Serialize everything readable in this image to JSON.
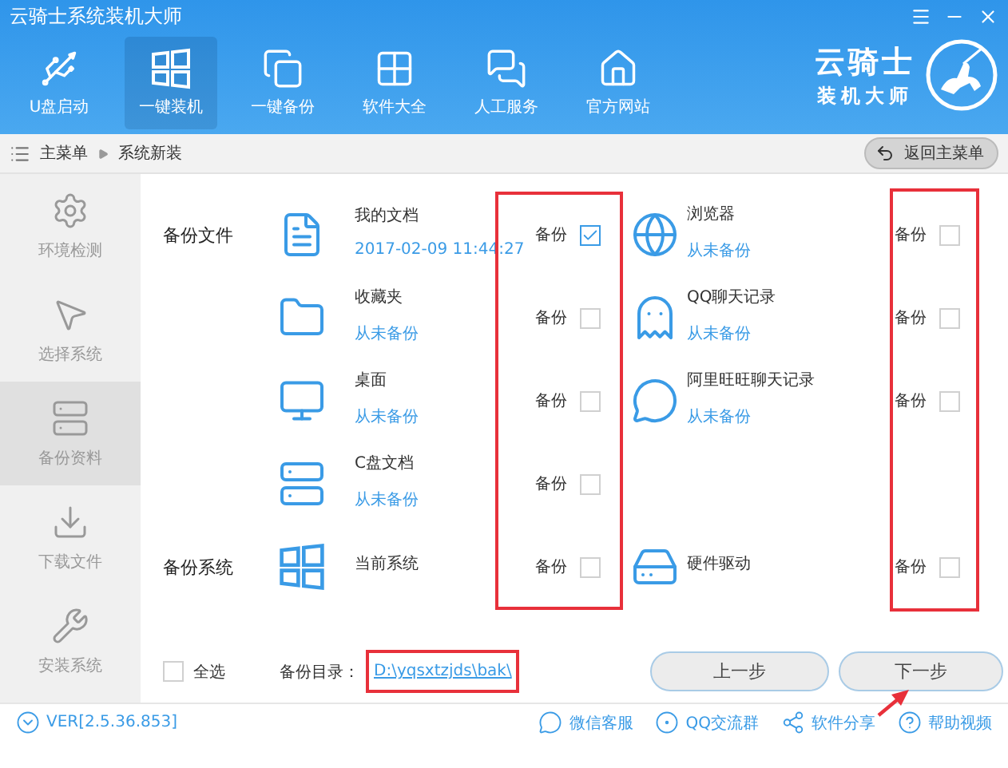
{
  "window": {
    "title": "云骑士系统装机大师"
  },
  "nav": [
    {
      "kind": "usb",
      "label": "U盘启动",
      "selected": false
    },
    {
      "kind": "windows",
      "label": "一键装机",
      "selected": true
    },
    {
      "kind": "copy",
      "label": "一键备份",
      "selected": false
    },
    {
      "kind": "grid",
      "label": "软件大全",
      "selected": false
    },
    {
      "kind": "chat",
      "label": "人工服务",
      "selected": false
    },
    {
      "kind": "home",
      "label": "官方网站",
      "selected": false
    }
  ],
  "logo": {
    "line1": "云骑士",
    "line2": "装机大师"
  },
  "breadcrumb": {
    "items": [
      "主菜单",
      "系统新装"
    ],
    "back_button": "返回主菜单"
  },
  "sidebar": [
    {
      "kind": "check",
      "label": "环境检测",
      "selected": false
    },
    {
      "kind": "pointer",
      "label": "选择系统",
      "selected": false
    },
    {
      "kind": "backup",
      "label": "备份资料",
      "selected": true
    },
    {
      "kind": "download",
      "label": "下载文件",
      "selected": false
    },
    {
      "kind": "install",
      "label": "安装系统",
      "selected": false
    }
  ],
  "rows": [
    {
      "section": "备份文件",
      "left": {
        "kind": "document",
        "name": "我的文档",
        "status": "2017-02-09 11:44:27",
        "check_label": "备份",
        "checked": true
      },
      "right": {
        "kind": "browser",
        "name": "浏览器",
        "status": "从未备份",
        "check_label": "备份",
        "checked": false
      }
    },
    {
      "left": {
        "kind": "folder",
        "name": "收藏夹",
        "status": "从未备份",
        "check_label": "备份",
        "checked": false
      },
      "right": {
        "kind": "penguin",
        "name": "QQ聊天记录",
        "status": "从未备份",
        "check_label": "备份",
        "checked": false
      }
    },
    {
      "left": {
        "kind": "monitor",
        "name": "桌面",
        "status": "从未备份",
        "check_label": "备份",
        "checked": false
      },
      "right": {
        "kind": "bubble",
        "name": "阿里旺旺聊天记录",
        "status": "从未备份",
        "check_label": "备份",
        "checked": false
      }
    },
    {
      "left": {
        "kind": "drive",
        "name": "C盘文档",
        "status": "从未备份",
        "check_label": "备份",
        "checked": false
      }
    },
    {
      "section": "备份系统",
      "left": {
        "kind": "windows",
        "name": "当前系统",
        "check_label": "备份",
        "checked": false
      },
      "right": {
        "kind": "disk",
        "name": "硬件驱动",
        "check_label": "备份",
        "checked": false
      }
    }
  ],
  "select_all": {
    "label": "全选",
    "checked": false
  },
  "backup_dir": {
    "label": "备份目录：",
    "path": "D:\\yqsxtzjds\\bak\\"
  },
  "buttons": [
    {
      "label": "上一步"
    },
    {
      "label": "下一步"
    }
  ],
  "version": "VER[2.5.36.853]",
  "footer_links": [
    {
      "kind": "wechat",
      "label": "微信客服"
    },
    {
      "kind": "qq",
      "label": "QQ交流群"
    },
    {
      "kind": "share",
      "label": "软件分享"
    },
    {
      "kind": "help",
      "label": "帮助视频"
    }
  ]
}
